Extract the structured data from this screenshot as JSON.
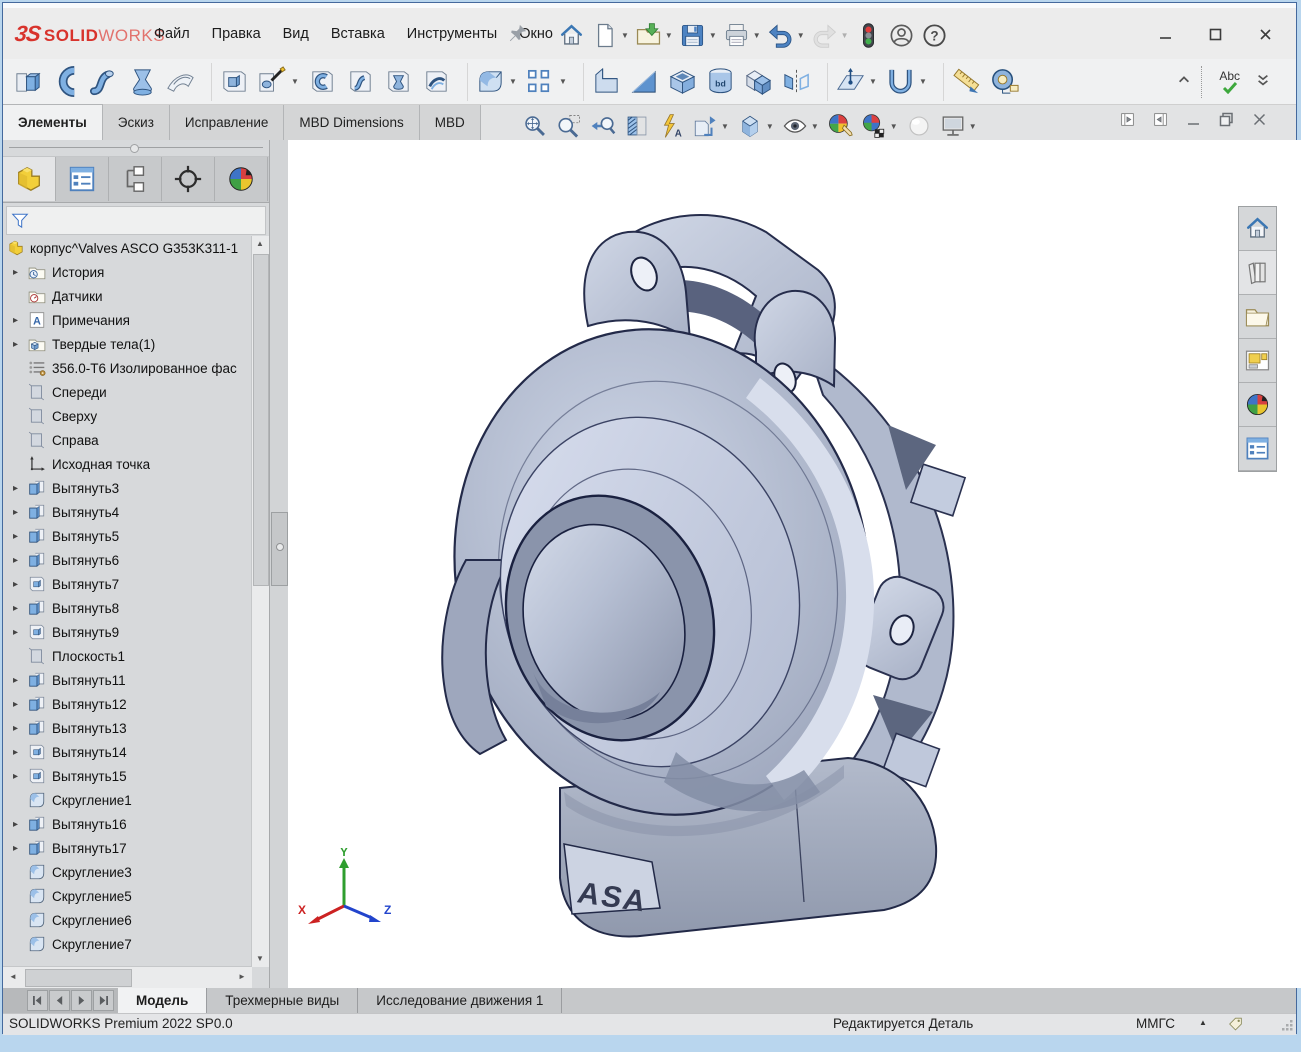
{
  "brand": {
    "mark": "3S",
    "solid": "SOLID",
    "works": "WORKS",
    "red": "#d8332c"
  },
  "menubar": {
    "items": [
      "Файл",
      "Правка",
      "Вид",
      "Вставка",
      "Инструменты",
      "Окно"
    ]
  },
  "quick_access": {
    "buttons": [
      {
        "name": "home",
        "icon": "home"
      },
      {
        "name": "new-document",
        "icon": "new",
        "dropdown": true
      },
      {
        "name": "open",
        "icon": "open",
        "dropdown": true
      },
      {
        "name": "save",
        "icon": "save",
        "dropdown": true
      },
      {
        "name": "print",
        "icon": "print",
        "dropdown": true
      },
      {
        "name": "undo",
        "icon": "undo",
        "dropdown": true
      },
      {
        "name": "redo",
        "icon": "redo",
        "dropdown": true,
        "disabled": true
      },
      {
        "name": "rebuild-traffic-light",
        "icon": "rebuild"
      },
      {
        "name": "account",
        "icon": "account"
      },
      {
        "name": "help",
        "icon": "help"
      }
    ]
  },
  "window_controls": {
    "names": [
      "minimize",
      "maximize",
      "close"
    ]
  },
  "ribbon": {
    "spellcheck_label": "Abc",
    "buttons": [
      {
        "name": "extruded-boss",
        "icon": "extruded-boss"
      },
      {
        "name": "revolved-boss",
        "icon": "revolved-boss"
      },
      {
        "name": "swept-boss",
        "icon": "swept-boss"
      },
      {
        "name": "lofted-boss",
        "icon": "lofted-boss"
      },
      {
        "name": "boundary-boss",
        "icon": "boundary-boss"
      },
      {
        "sep": true
      },
      {
        "name": "extruded-cut",
        "icon": "extruded-cut"
      },
      {
        "name": "hole-wizard",
        "icon": "hole-wizard",
        "dropdown": true
      },
      {
        "name": "revolved-cut",
        "icon": "revolved-cut"
      },
      {
        "name": "swept-cut",
        "icon": "swept-cut"
      },
      {
        "name": "lofted-cut",
        "icon": "lofted-cut"
      },
      {
        "name": "boundary-cut",
        "icon": "boundary-cut"
      },
      {
        "sep": true
      },
      {
        "name": "fillet",
        "icon": "fillet",
        "dropdown": true
      },
      {
        "name": "linear-pattern",
        "icon": "linear-pattern",
        "dropdown": true
      },
      {
        "sep": true
      },
      {
        "name": "rib",
        "icon": "rib"
      },
      {
        "name": "draft",
        "icon": "draft"
      },
      {
        "name": "shell",
        "icon": "shell"
      },
      {
        "name": "wrap",
        "icon": "wrap"
      },
      {
        "name": "intersect",
        "icon": "intersect"
      },
      {
        "name": "mirror",
        "icon": "mirror"
      },
      {
        "sep": true
      },
      {
        "name": "reference-geometry",
        "icon": "reference-geometry",
        "dropdown": true
      },
      {
        "name": "curves",
        "icon": "curves",
        "dropdown": true
      },
      {
        "sep": true
      },
      {
        "name": "smart-dimension",
        "icon": "smart-dimension"
      },
      {
        "name": "measure",
        "icon": "measure"
      }
    ]
  },
  "command_tabs": {
    "items": [
      {
        "label": "Элементы",
        "name": "tab-features",
        "active": true
      },
      {
        "label": "Эскиз",
        "name": "tab-sketch"
      },
      {
        "label": "Исправление",
        "name": "tab-repair"
      },
      {
        "label": "MBD Dimensions",
        "name": "tab-mbd-dimensions"
      },
      {
        "label": "MBD",
        "name": "tab-mbd"
      }
    ]
  },
  "headsup": {
    "buttons": [
      {
        "name": "zoom-to-fit",
        "icon": "zoom-fit"
      },
      {
        "name": "zoom-to-area",
        "icon": "zoom-area"
      },
      {
        "name": "previous-view",
        "icon": "prev-view"
      },
      {
        "name": "section-view",
        "icon": "section-view"
      },
      {
        "name": "annotation-view",
        "icon": "drawing-view"
      },
      {
        "name": "view-orientation",
        "icon": "view-orientation",
        "dropdown": true
      },
      {
        "name": "display-style",
        "icon": "display-style",
        "dropdown": true
      },
      {
        "name": "hide-show-items",
        "icon": "hide-show",
        "dropdown": true
      },
      {
        "name": "edit-appearance",
        "icon": "edit-appearance"
      },
      {
        "name": "apply-scene",
        "icon": "apply-scene",
        "dropdown": true
      },
      {
        "name": "view-settings",
        "icon": "view-settings"
      },
      {
        "name": "screen-options",
        "icon": "screen",
        "dropdown": true
      }
    ]
  },
  "fm_tabs": {
    "items": [
      {
        "name": "featuremanager-tree",
        "icon": "fm-part",
        "active": true
      },
      {
        "name": "propertymanager",
        "icon": "fm-props"
      },
      {
        "name": "configurationmanager",
        "icon": "fm-config"
      },
      {
        "name": "dimxpertmanager",
        "icon": "fm-dimx"
      },
      {
        "name": "displaymanager",
        "icon": "sphere"
      }
    ]
  },
  "feature_tree": {
    "root": "корпус^Valves ASCO G353K311-1",
    "items": [
      {
        "label": "История",
        "icon": "t-history",
        "expandable": true
      },
      {
        "label": "Датчики",
        "icon": "t-sensors"
      },
      {
        "label": "Примечания",
        "icon": "t-annot",
        "expandable": true
      },
      {
        "label": "Твердые тела(1)",
        "icon": "t-solids",
        "expandable": true
      },
      {
        "label": "356.0-T6 Изолированное фас",
        "icon": "t-material"
      },
      {
        "label": "Спереди",
        "icon": "t-plane"
      },
      {
        "label": "Сверху",
        "icon": "t-plane"
      },
      {
        "label": "Справа",
        "icon": "t-plane"
      },
      {
        "label": "Исходная точка",
        "icon": "t-origin"
      },
      {
        "label": "Вытянуть3",
        "icon": "t-boss",
        "expandable": true
      },
      {
        "label": "Вытянуть4",
        "icon": "t-boss",
        "expandable": true
      },
      {
        "label": "Вытянуть5",
        "icon": "t-boss",
        "expandable": true
      },
      {
        "label": "Вытянуть6",
        "icon": "t-boss",
        "expandable": true
      },
      {
        "label": "Вытянуть7",
        "icon": "t-cut",
        "expandable": true
      },
      {
        "label": "Вытянуть8",
        "icon": "t-boss",
        "expandable": true
      },
      {
        "label": "Вытянуть9",
        "icon": "t-cut",
        "expandable": true
      },
      {
        "label": "Плоскость1",
        "icon": "t-plane"
      },
      {
        "label": "Вытянуть11",
        "icon": "t-boss",
        "expandable": true
      },
      {
        "label": "Вытянуть12",
        "icon": "t-boss",
        "expandable": true
      },
      {
        "label": "Вытянуть13",
        "icon": "t-boss",
        "expandable": true
      },
      {
        "label": "Вытянуть14",
        "icon": "t-cut",
        "expandable": true
      },
      {
        "label": "Вытянуть15",
        "icon": "t-cut",
        "expandable": true
      },
      {
        "label": "Скругление1",
        "icon": "t-fillet"
      },
      {
        "label": "Вытянуть16",
        "icon": "t-boss",
        "expandable": true
      },
      {
        "label": "Вытянуть17",
        "icon": "t-boss",
        "expandable": true
      },
      {
        "label": "Скругление3",
        "icon": "t-fillet"
      },
      {
        "label": "Скругление5",
        "icon": "t-fillet"
      },
      {
        "label": "Скругление6",
        "icon": "t-fillet"
      },
      {
        "label": "Скругление7",
        "icon": "t-fillet"
      }
    ]
  },
  "taskpane": {
    "buttons": [
      {
        "name": "home",
        "icon": "home"
      },
      {
        "name": "design-library",
        "icon": "tp-library",
        "active": true
      },
      {
        "name": "file-explorer",
        "icon": "tp-folder"
      },
      {
        "name": "view-palette",
        "icon": "tp-palette"
      },
      {
        "name": "appearances-scenes",
        "icon": "sphere"
      },
      {
        "name": "custom-properties",
        "icon": "fm-props"
      }
    ]
  },
  "bottom_tabs": {
    "items": [
      {
        "label": "Модель",
        "name": "tab-model",
        "active": true
      },
      {
        "label": "Трехмерные виды",
        "name": "tab-3d-views"
      },
      {
        "label": "Исследование движения 1",
        "name": "tab-motion-study-1"
      }
    ]
  },
  "statusbar": {
    "left": "SOLIDWORKS Premium 2022 SP0.0",
    "mode": "Редактируется Деталь",
    "units": "ММГС"
  },
  "viewport": {
    "background": "#ffffff",
    "model_color": "#aab4c9",
    "edge_color": "#232a49",
    "embossed_text": "ASA",
    "triad": {
      "x": "X",
      "y": "Y",
      "z": "Z"
    }
  }
}
